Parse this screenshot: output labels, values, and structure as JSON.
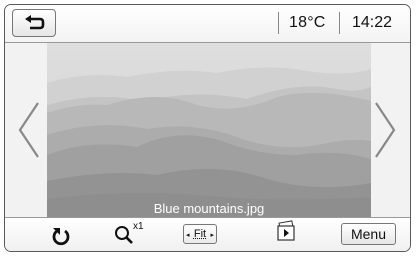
{
  "header": {
    "back_icon": "back-arrow-icon",
    "temperature": "18°C",
    "time": "14:22"
  },
  "viewer": {
    "filename": "Blue mountains.jpg",
    "prev_icon": "chevron-left-icon",
    "next_icon": "chevron-right-icon"
  },
  "toolbar": {
    "rotate_icon": "rotate-icon",
    "zoom_label": "x1",
    "zoom_icon": "zoom-icon",
    "fit_label": "Fit",
    "slideshow_icon": "slideshow-icon",
    "menu_label": "Menu"
  },
  "colors": {
    "frame": "#5a5a5a",
    "background": "#f2f2f2",
    "photo_sky": "#d7d7d7",
    "photo_ridge_dark": "#8e8e8e"
  }
}
